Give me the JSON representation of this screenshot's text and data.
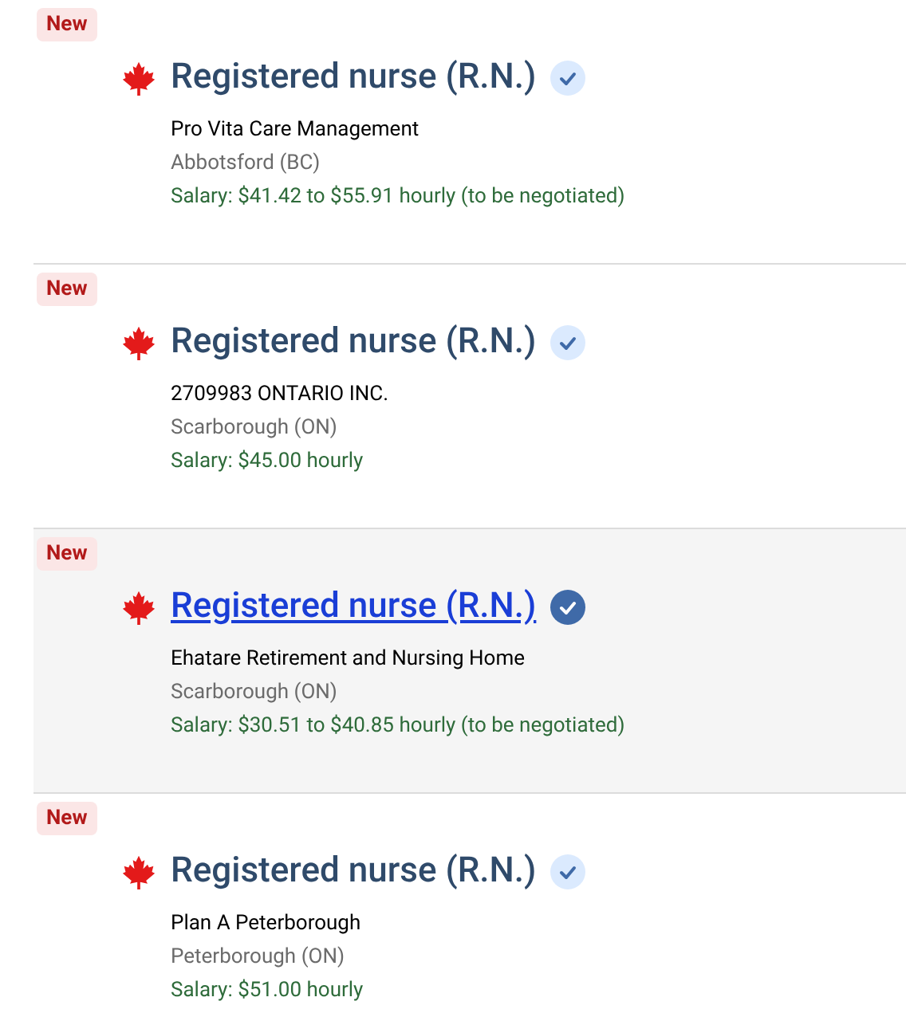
{
  "jobs": [
    {
      "badge": "New",
      "title": "Registered nurse (R.N.)",
      "verified": true,
      "highlighted": false,
      "employer": "Pro Vita Care Management",
      "location": "Abbotsford (BC)",
      "salary": "Salary: $41.42 to $55.91 hourly (to be negotiated)"
    },
    {
      "badge": "New",
      "title": "Registered nurse (R.N.)",
      "verified": true,
      "highlighted": false,
      "employer": "2709983 ONTARIO INC.",
      "location": "Scarborough (ON)",
      "salary": "Salary: $45.00 hourly"
    },
    {
      "badge": "New",
      "title": "Registered nurse (R.N.)",
      "verified": true,
      "highlighted": true,
      "employer": "Ehatare Retirement and Nursing Home",
      "location": "Scarborough (ON)",
      "salary": "Salary: $30.51 to $40.85 hourly (to be negotiated)"
    },
    {
      "badge": "New",
      "title": "Registered nurse (R.N.)",
      "verified": true,
      "highlighted": false,
      "employer": "Plan A Peterborough",
      "location": "Peterborough (ON)",
      "salary": "Salary: $51.00 hourly"
    }
  ]
}
